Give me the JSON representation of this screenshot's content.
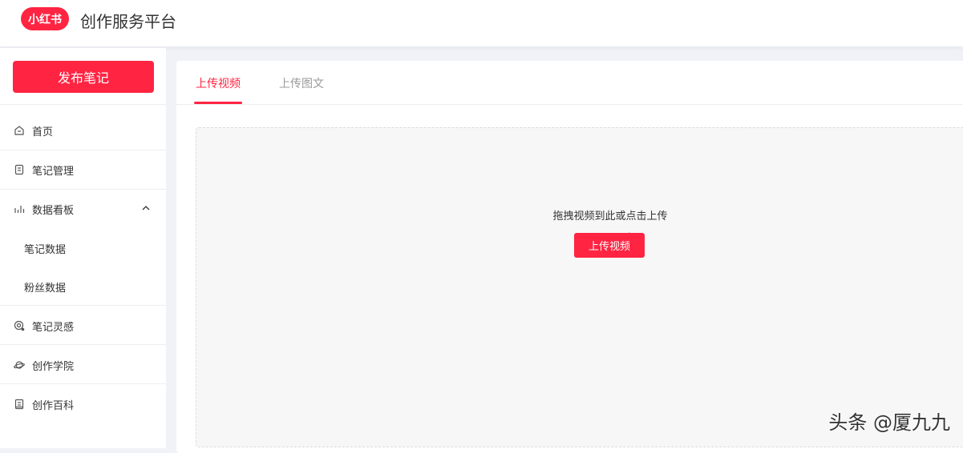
{
  "header": {
    "logo": "小红书",
    "title": "创作服务平台"
  },
  "sidebar": {
    "publish": "发布笔记",
    "items": [
      {
        "label": "首页",
        "icon": "home-icon"
      },
      {
        "label": "笔记管理",
        "icon": "note-icon"
      },
      {
        "label": "数据看板",
        "icon": "bar-chart-icon"
      },
      {
        "label": "笔记数据"
      },
      {
        "label": "粉丝数据"
      },
      {
        "label": "笔记灵感",
        "icon": "inspiration-icon"
      },
      {
        "label": "创作学院",
        "icon": "planet-icon"
      },
      {
        "label": "创作百科",
        "icon": "book-icon"
      }
    ]
  },
  "main": {
    "tabs": [
      {
        "label": "上传视频"
      },
      {
        "label": "上传图文"
      }
    ],
    "drop_text": "拖拽视频到此或点击上传",
    "upload_button": "上传视频"
  },
  "watermark": "头条 @厦九九",
  "colors": {
    "accent": "#ff2442"
  }
}
